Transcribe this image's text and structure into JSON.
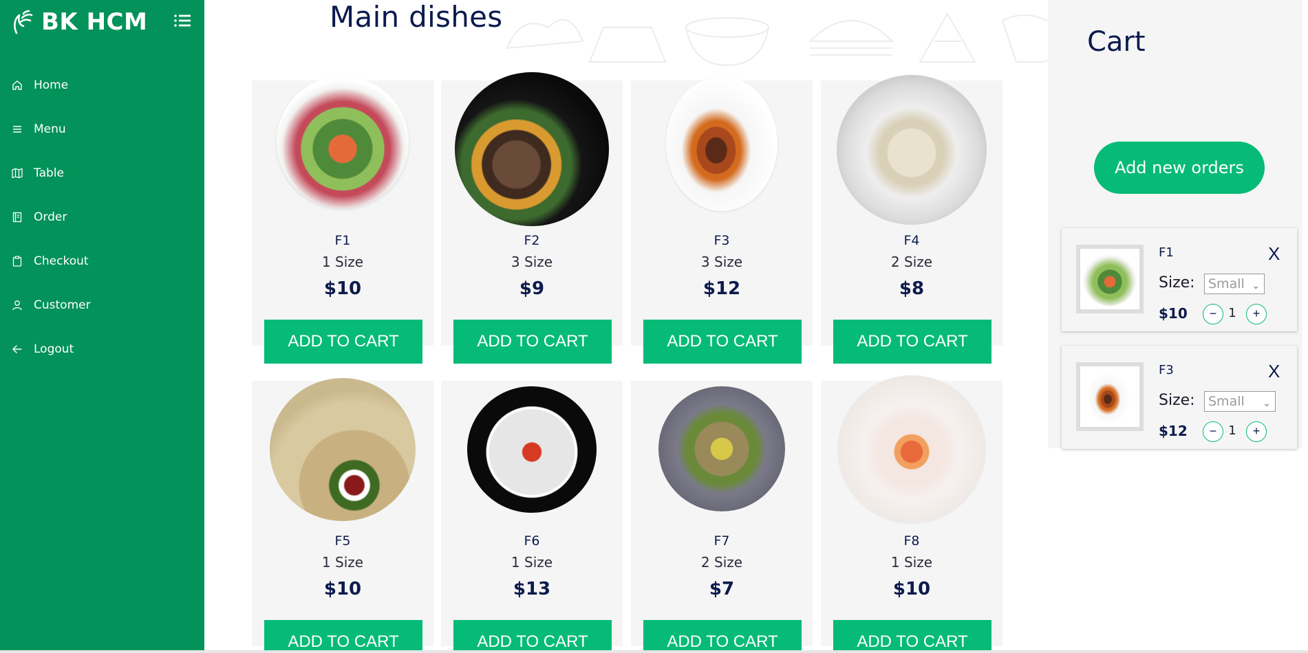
{
  "brand": {
    "name": "BK HCM"
  },
  "nav": {
    "items": [
      {
        "label": "Home",
        "icon": "home-icon"
      },
      {
        "label": "Menu",
        "icon": "list-icon"
      },
      {
        "label": "Table",
        "icon": "map-icon"
      },
      {
        "label": "Order",
        "icon": "book-icon"
      },
      {
        "label": "Checkout",
        "icon": "clipboard-icon"
      },
      {
        "label": "Customer",
        "icon": "user-icon"
      },
      {
        "label": "Logout",
        "icon": "arrow-left-icon"
      }
    ]
  },
  "main": {
    "title": "Main dishes",
    "add_to_cart_label": "ADD TO CART",
    "dishes": [
      {
        "name": "F1",
        "size": "1 Size",
        "price": "$10"
      },
      {
        "name": "F2",
        "size": "3 Size",
        "price": "$9"
      },
      {
        "name": "F3",
        "size": "3 Size",
        "price": "$12"
      },
      {
        "name": "F4",
        "size": "2 Size",
        "price": "$8"
      },
      {
        "name": "F5",
        "size": "1 Size",
        "price": "$10"
      },
      {
        "name": "F6",
        "size": "1 Size",
        "price": "$13"
      },
      {
        "name": "F7",
        "size": "2 Size",
        "price": "$7"
      },
      {
        "name": "F8",
        "size": "1 Size",
        "price": "$10"
      }
    ]
  },
  "cart": {
    "title": "Cart",
    "add_orders_label": "Add new orders",
    "remove_label": "X",
    "size_label": "Size:",
    "items": [
      {
        "name": "F1",
        "size": "Small",
        "price": "$10",
        "qty": "1"
      },
      {
        "name": "F3",
        "size": "Small",
        "price": "$12",
        "qty": "1"
      }
    ],
    "minus": "−",
    "plus": "+"
  },
  "colors": {
    "sidebar": "#039259",
    "accent": "#06bb77",
    "text_dark": "#0b1a4d",
    "card_bg": "#f5f5f5"
  }
}
